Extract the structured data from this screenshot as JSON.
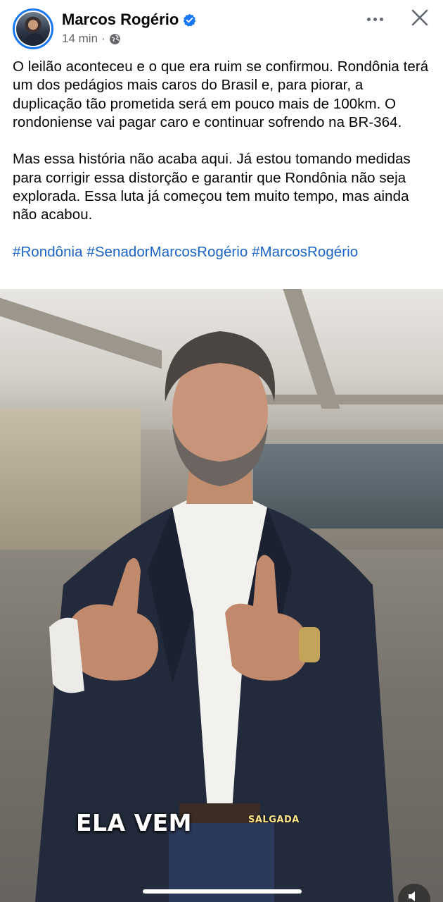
{
  "author": {
    "name": "Marcos Rogério",
    "verified_icon": "verified-badge-icon",
    "time": "14 min",
    "separator": "·",
    "audience_icon": "globe-icon"
  },
  "header_actions": {
    "more_icon": "more-horizontal-icon",
    "close_icon": "close-icon"
  },
  "post": {
    "paragraph1": "O leilão aconteceu e o que era ruim se confirmou. Rondônia terá um dos pedágios mais caros do Brasil e, para piorar, a duplicação tão prometida será em pouco mais de 100km. O rondoniense vai pagar caro e continuar sofrendo na BR-364.",
    "paragraph2": "Mas essa história não acaba aqui. Já estou tomando medidas para corrigir essa distorção e garantir que Rondônia não seja explorada. Essa luta já começou tem muito tempo, mas ainda não acabou.",
    "hashtags": [
      "#Rondônia",
      "#SenadorMarcosRogério",
      "#MarcosRogério"
    ]
  },
  "video": {
    "caption_main": "ELA VEM",
    "caption_sub": "SALGADA",
    "mute_icon": "speaker-icon"
  },
  "colors": {
    "brand_blue": "#1877f2",
    "hashtag": "#1b64c4",
    "secondary_text": "#65676b"
  }
}
